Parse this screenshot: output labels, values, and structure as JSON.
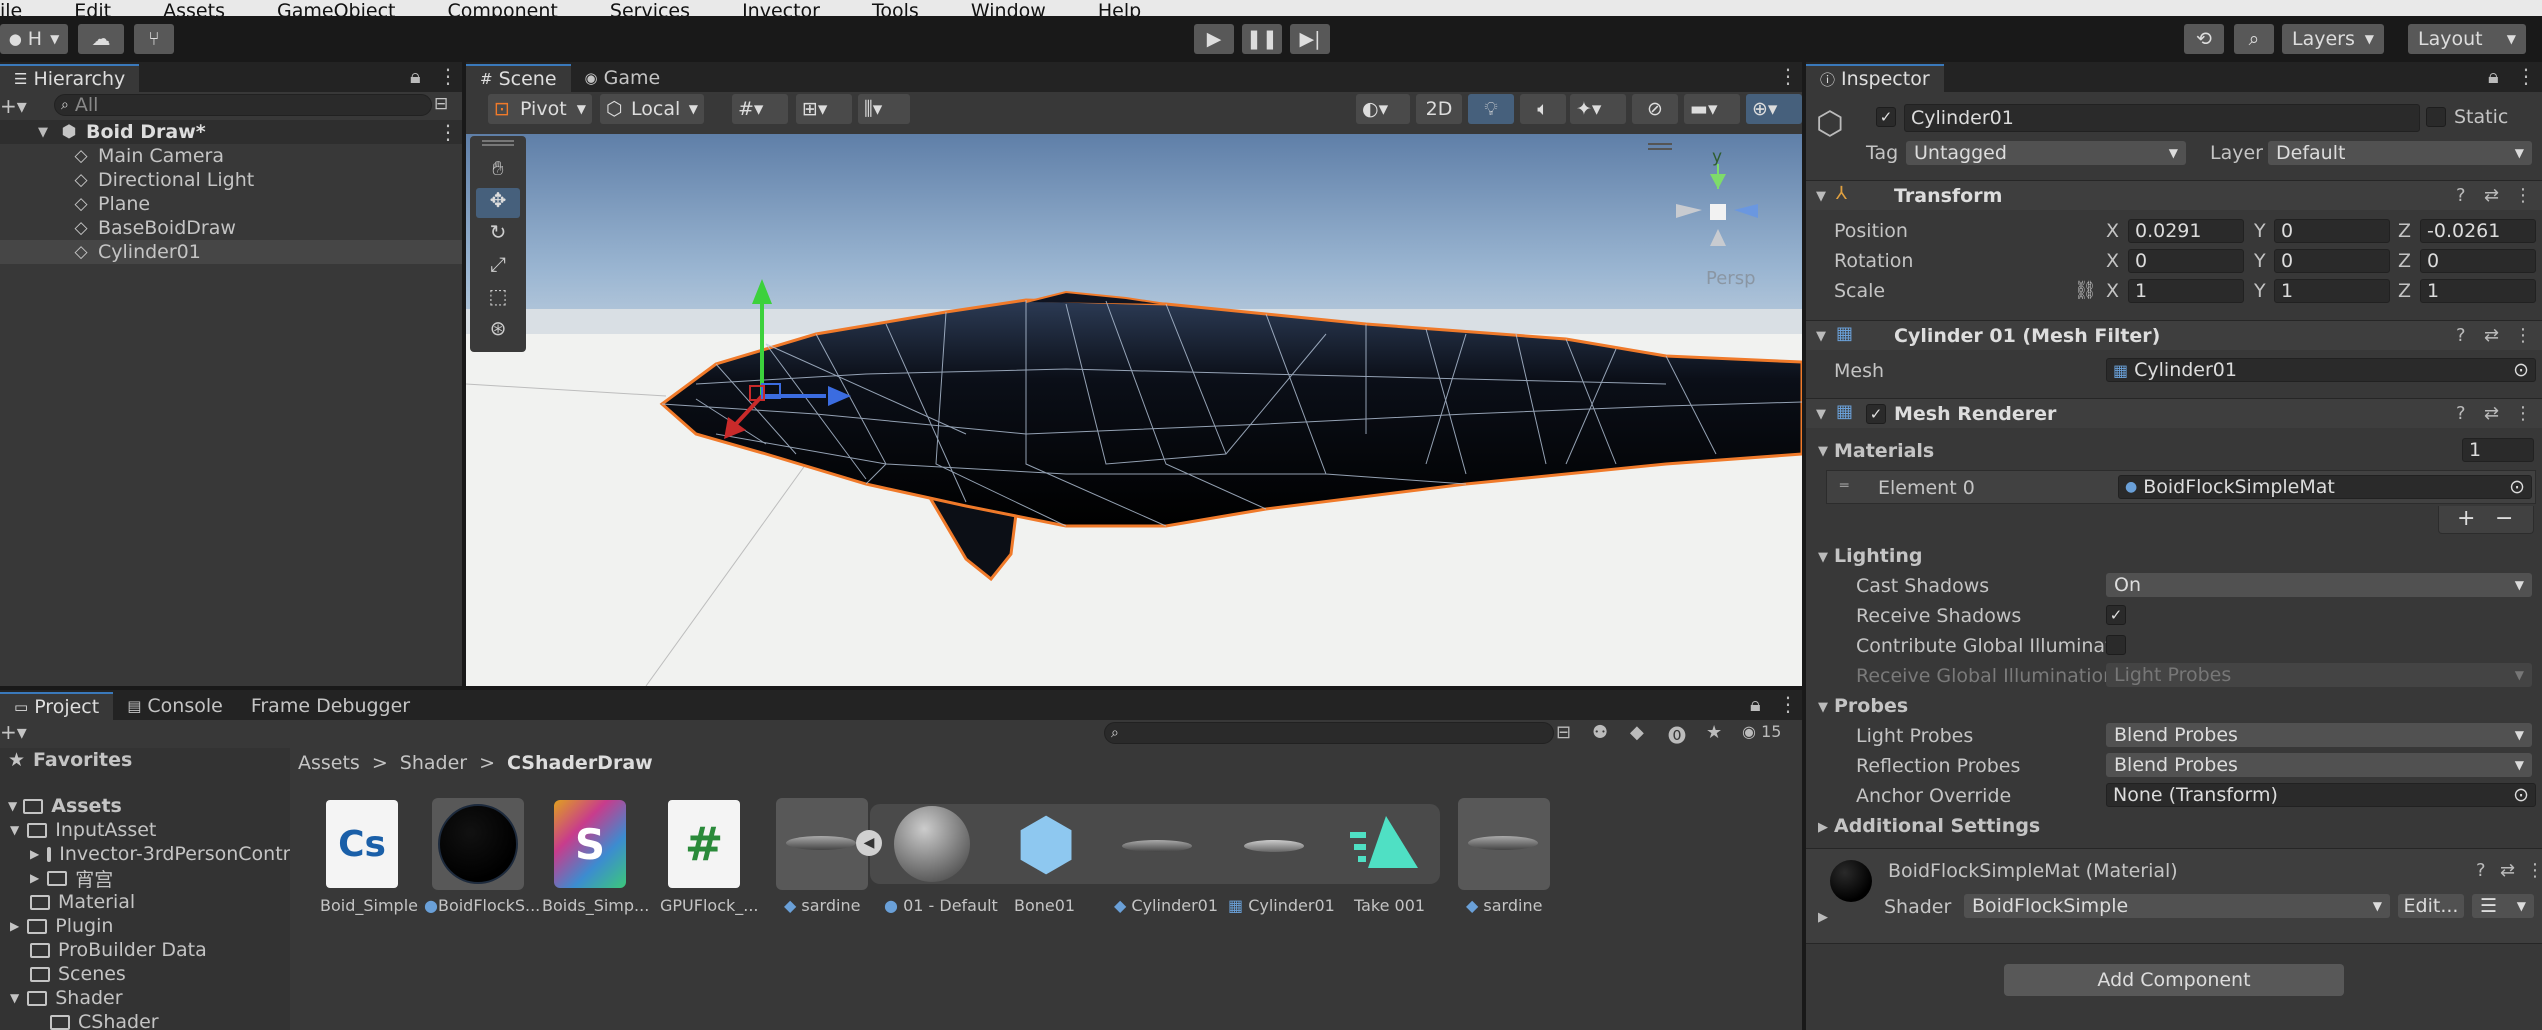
{
  "menu": [
    "ile",
    "Edit",
    "Assets",
    "GameObject",
    "Component",
    "Services",
    "Invector",
    "Tools",
    "Window",
    "Help"
  ],
  "toolbar": {
    "account": "H",
    "layers": "Layers",
    "layout": "Layout"
  },
  "hierarchy": {
    "tab": "Hierarchy",
    "search_placeholder": "All",
    "scene": "Boid Draw*",
    "items": [
      "Main Camera",
      "Directional Light",
      "Plane",
      "BaseBoidDraw",
      "Cylinder01"
    ]
  },
  "scene_tabs": [
    "Scene",
    "Game"
  ],
  "scene_toolbar": {
    "pivot": "Pivot",
    "local": "Local",
    "mode2d": "2D",
    "persp": "Persp",
    "gizmo_y": "y"
  },
  "inspector": {
    "tab": "Inspector",
    "object_name": "Cylinder01",
    "static": "Static",
    "tag_label": "Tag",
    "tag": "Untagged",
    "layer_label": "Layer",
    "layer": "Default",
    "transform": {
      "title": "Transform",
      "position_label": "Position",
      "rotation_label": "Rotation",
      "scale_label": "Scale",
      "position": [
        "0.0291",
        "0",
        "-0.0261"
      ],
      "rotation": [
        "0",
        "0",
        "0"
      ],
      "scale": [
        "1",
        "1",
        "1"
      ],
      "axes": [
        "X",
        "Y",
        "Z"
      ]
    },
    "mesh_filter": {
      "title": "Cylinder 01 (Mesh Filter)",
      "mesh_label": "Mesh",
      "mesh": "Cylinder01"
    },
    "mesh_renderer": {
      "title": "Mesh Renderer",
      "materials_label": "Materials",
      "materials_count": "1",
      "element_label": "Element 0",
      "element_value": "BoidFlockSimpleMat",
      "lighting_label": "Lighting",
      "cast_shadows_label": "Cast Shadows",
      "cast_shadows": "On",
      "receive_shadows_label": "Receive Shadows",
      "contribute_gi_label": "Contribute Global Illuminatio",
      "receive_gi_label": "Receive Global Illumination",
      "receive_gi": "Light Probes",
      "probes_label": "Probes",
      "light_probes_label": "Light Probes",
      "light_probes": "Blend Probes",
      "reflection_probes_label": "Reflection Probes",
      "reflection_probes": "Blend Probes",
      "anchor_label": "Anchor Override",
      "anchor": "None (Transform)",
      "additional": "Additional Settings"
    },
    "material": {
      "title": "BoidFlockSimpleMat (Material)",
      "shader_label": "Shader",
      "shader": "BoidFlockSimple",
      "edit": "Edit..."
    },
    "add_component": "Add Component"
  },
  "project": {
    "tabs": [
      "Project",
      "Console",
      "Frame Debugger"
    ],
    "visible_count": "15",
    "favorites": "Favorites",
    "assets_root": "Assets",
    "tree": [
      "InputAsset",
      "Invector-3rdPersonContr",
      "宵宫",
      "Material",
      "Plugin",
      "ProBuilder Data",
      "Scenes",
      "Shader",
      "CShader"
    ],
    "breadcrumb": [
      "Assets",
      "Shader",
      "CShaderDraw"
    ],
    "assets": [
      "Boid_Simple",
      "BoidFlockS...",
      "Boids_Simp...",
      "GPUFlock_...",
      "sardine",
      "01 - Default",
      "Bone01",
      "Cylinder01",
      "Cylinder01",
      "Take 001",
      "sardine"
    ],
    "thumb_labels": {
      "cs": "Cs",
      "s": "S",
      "hash": "#"
    }
  },
  "colors": {
    "accent": "#3a79bb",
    "selection_outline": "#f07a2a",
    "panel": "#383838",
    "toolbar": "#191919"
  }
}
